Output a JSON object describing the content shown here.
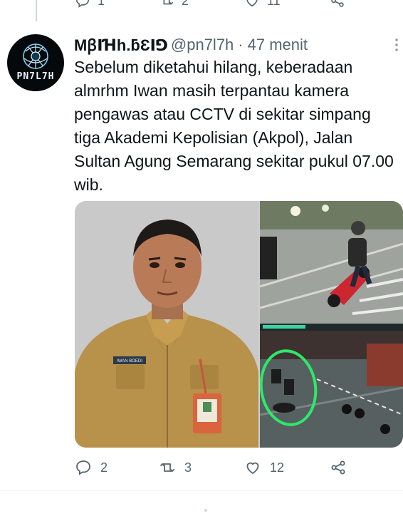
{
  "previous_tweet": {
    "reply_count": "1",
    "retweet_count": "2",
    "like_count": "11"
  },
  "author": {
    "display_name": "MꞵꓲꞪh.ƃƐꓲꓨ",
    "handle": "@pn7l7h",
    "time": "47 menit",
    "avatar_text": "PN7L7H"
  },
  "tweet": {
    "text": "Sebelum diketahui hilang, keberadaan almrhm Iwan masih terpantau kamera pengawas atau CCTV di sekitar simpang tiga Akademi Kepolisian (Akpol), Jalan Sultan Agung Semarang sekitar pukul 07.00 wib.",
    "id_card_label": "IWAN BOEDI"
  },
  "actions": {
    "reply_count": "2",
    "retweet_count": "3",
    "like_count": "12"
  },
  "colors": {
    "text_primary": "#0f1419",
    "text_secondary": "#536471",
    "divider": "#eff3f4",
    "cctv_highlight": "#2ee86a"
  },
  "icons": [
    "reply-icon",
    "retweet-icon",
    "like-icon",
    "share-icon",
    "more-icon"
  ]
}
